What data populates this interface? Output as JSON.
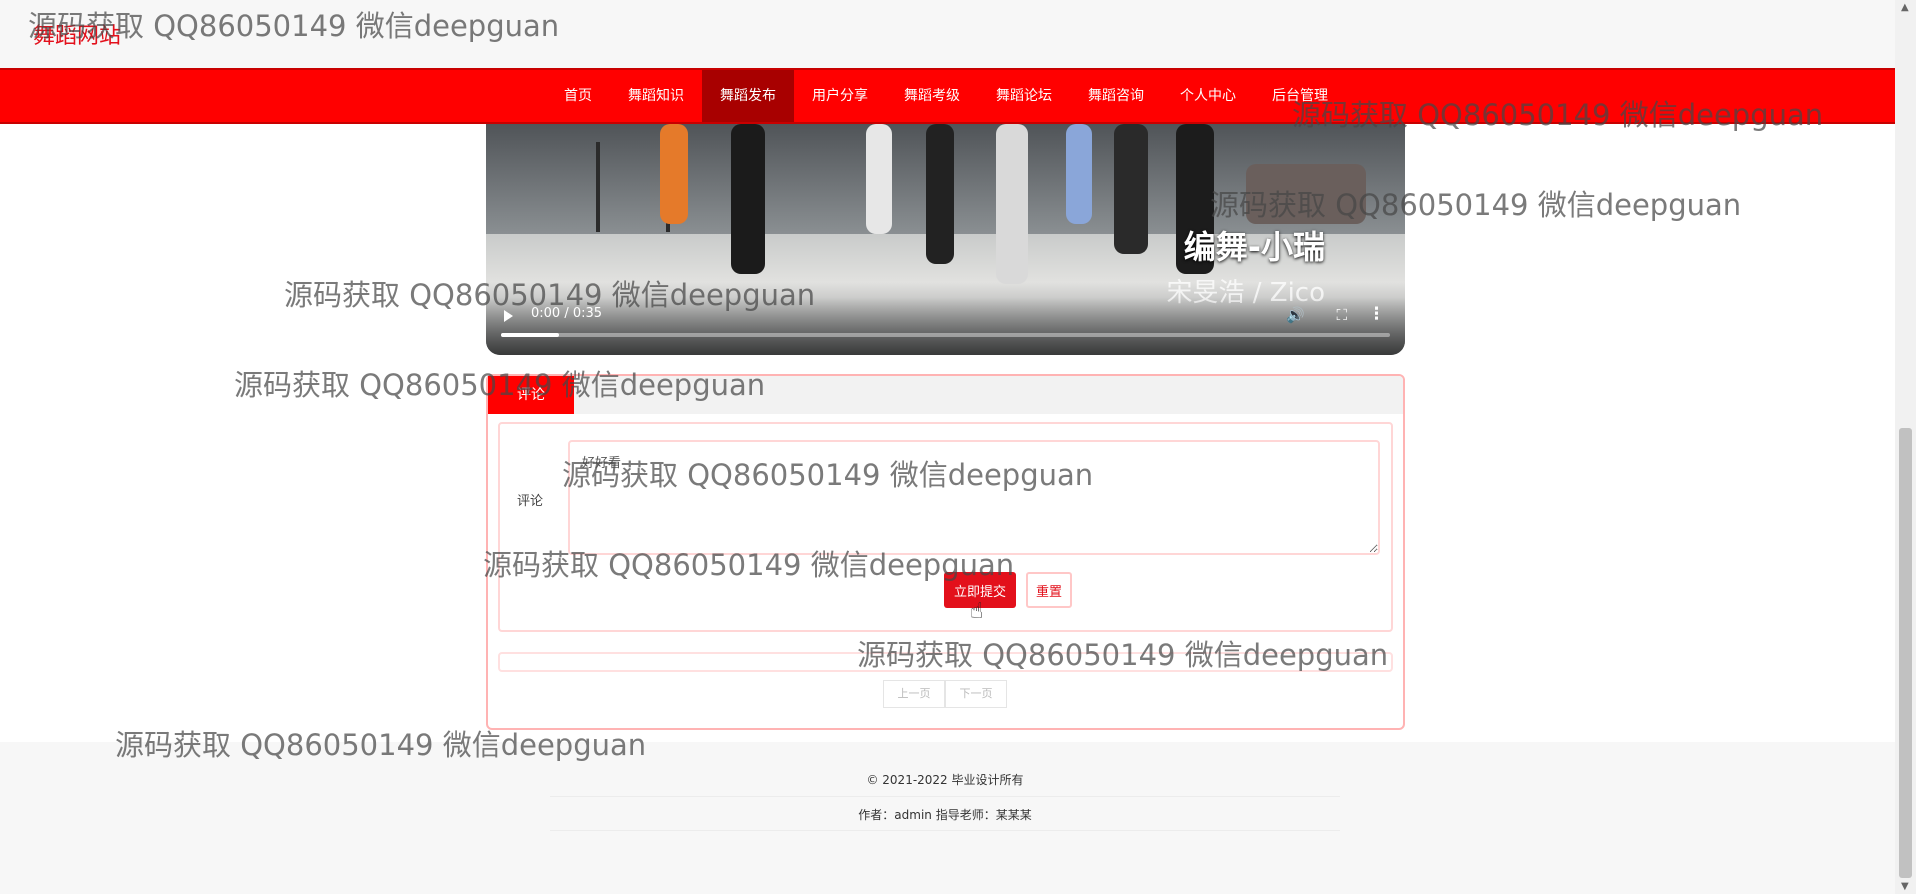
{
  "site": {
    "logo": "舞蹈网站"
  },
  "nav": {
    "items": [
      {
        "label": "首页"
      },
      {
        "label": "舞蹈知识"
      },
      {
        "label": "舞蹈发布",
        "active": true
      },
      {
        "label": "用户分享"
      },
      {
        "label": "舞蹈考级"
      },
      {
        "label": "舞蹈论坛"
      },
      {
        "label": "舞蹈咨询"
      },
      {
        "label": "个人中心"
      },
      {
        "label": "后台管理"
      }
    ]
  },
  "video": {
    "caption": "编舞-小瑞",
    "subcaption": "宋旻浩 / Zico",
    "time": "0:00 / 0:35",
    "progress": 0.065
  },
  "comment": {
    "tab_label": "评论",
    "field_label": "评论",
    "textarea_value": "好好看",
    "submit_label": "立即提交",
    "reset_label": "重置"
  },
  "pager": {
    "prev_label": "上一页",
    "next_label": "下一页"
  },
  "footer": {
    "copyright": "© 2021-2022 毕业设计所有",
    "author": "作者：admin 指导老师：某某某"
  },
  "watermark": {
    "text": "源码获取 QQ86050149 微信deepguan"
  },
  "colors": {
    "brand_red": "#ff0000",
    "nav_active": "#a80000",
    "button_red": "#e3101b"
  }
}
